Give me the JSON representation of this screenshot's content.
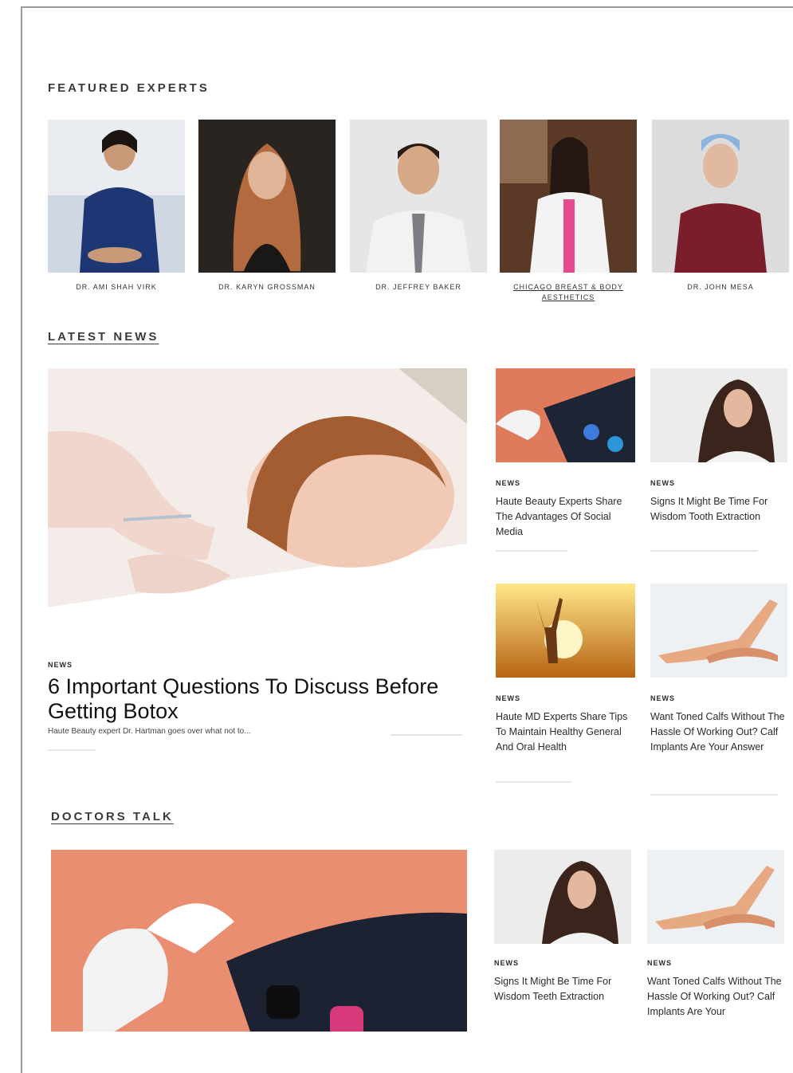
{
  "sections": {
    "featured_experts": "FEATURED EXPERTS",
    "latest_news": "LATEST NEWS",
    "doctors_talk": "DOCTORS TALK"
  },
  "experts": [
    {
      "name": "DR. AMI SHAH VIRK"
    },
    {
      "name": "DR. KARYN GROSSMAN"
    },
    {
      "name": "DR. JEFFREY BAKER"
    },
    {
      "name": "CHICAGO BREAST & BODY AESTHETICS"
    },
    {
      "name": "DR. JOHN MESA"
    }
  ],
  "latest_news": {
    "featured": {
      "tag": "NEWS",
      "title": "6 Important Questions To Discuss Before Getting Botox",
      "excerpt": "Haute Beauty expert Dr. Hartman goes over what not to..."
    },
    "cards": [
      {
        "tag": "NEWS",
        "title": "Haute Beauty Experts Share The Advantages Of Social Media"
      },
      {
        "tag": "NEWS",
        "title": "Signs It Might Be Time For Wisdom Tooth Extraction"
      },
      {
        "tag": "NEWS",
        "title": "Haute MD Experts Share Tips To Maintain Healthy General And Oral Health"
      },
      {
        "tag": "NEWS",
        "title": "Want Toned Calfs Without The Hassle Of Working Out? Calf Implants Are Your Answer"
      }
    ]
  },
  "doctors_talk": {
    "cards": [
      {
        "tag": "NEWS",
        "title": "Signs It Might Be Time For Wisdom Teeth Extraction"
      },
      {
        "tag": "NEWS",
        "title": "Want Toned Calfs Without The Hassle Of Working Out? Calf Implants Are Your"
      }
    ]
  },
  "colors": {
    "accent_text": "#1d1d1d",
    "rule": "#e6e6e6",
    "divider": "#9a9a9a"
  }
}
